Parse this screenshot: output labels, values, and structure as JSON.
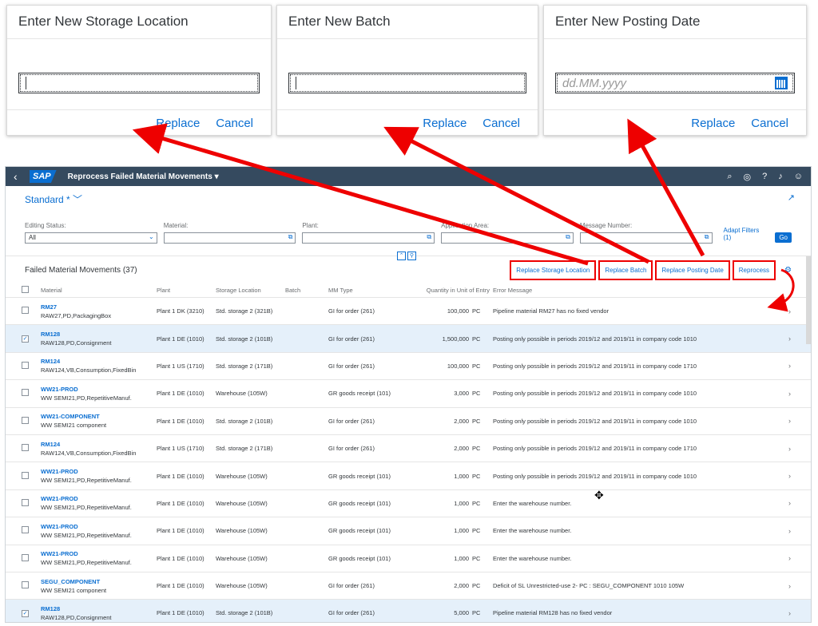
{
  "dialogs": [
    {
      "title": "Enter New Storage Location",
      "value": "",
      "placeholder": "",
      "replace": "Replace",
      "cancel": "Cancel",
      "has_calendar": false
    },
    {
      "title": "Enter New Batch",
      "value": "",
      "placeholder": "",
      "replace": "Replace",
      "cancel": "Cancel",
      "has_calendar": false
    },
    {
      "title": "Enter New Posting Date",
      "value": "",
      "placeholder": "dd.MM.yyyy",
      "replace": "Replace",
      "cancel": "Cancel",
      "has_calendar": true
    }
  ],
  "shell": {
    "back": "‹",
    "logo": "SAP",
    "title": "Reprocess Failed Material Movements ▾"
  },
  "header": {
    "variant": "Standard * ﹀"
  },
  "filters": [
    {
      "label": "Editing Status:",
      "value": "All",
      "icon": "chevron-down-icon"
    },
    {
      "label": "Material:",
      "value": "",
      "icon": "value-help-icon"
    },
    {
      "label": "Plant:",
      "value": "",
      "icon": "value-help-icon"
    },
    {
      "label": "Application Area:",
      "value": "",
      "icon": "value-help-icon"
    },
    {
      "label": "Message Number:",
      "value": "",
      "icon": "value-help-icon"
    }
  ],
  "filterbar": {
    "adapt": "Adapt Filters (1)",
    "go": "Go"
  },
  "table": {
    "title": "Failed Material Movements (37)",
    "actions": [
      "Replace Storage Location",
      "Replace Batch",
      "Replace Posting Date",
      "Reprocess"
    ],
    "columns": [
      "Material",
      "Plant",
      "Storage Location",
      "Batch",
      "MM Type",
      "Quantity in Unit of Entry",
      "Error Message"
    ],
    "rows": [
      {
        "id": "RM27",
        "desc": "RAW27,PD,PackagingBox",
        "plant": "Plant 1 DK (3210)",
        "sloc": "Std. storage 2 (321B)",
        "batch": "",
        "mmt": "GI for order (261)",
        "qty": "100,000",
        "unit": "PC",
        "err": "Pipeline material RM27 has no fixed vendor",
        "sel": false
      },
      {
        "id": "RM128",
        "desc": "RAW128,PD,Consignment",
        "plant": "Plant 1 DE (1010)",
        "sloc": "Std. storage 2 (101B)",
        "batch": "",
        "mmt": "GI for order (261)",
        "qty": "1,500,000",
        "unit": "PC",
        "err": "Posting only possible in periods 2019/12 and 2019/11 in company code 1010",
        "sel": true
      },
      {
        "id": "RM124",
        "desc": "RAW124,VB,Consumption,FixedBin",
        "plant": "Plant 1 US (1710)",
        "sloc": "Std. storage 2 (171B)",
        "batch": "",
        "mmt": "GI for order (261)",
        "qty": "100,000",
        "unit": "PC",
        "err": "Posting only possible in periods 2019/12 and 2019/11 in company code 1710",
        "sel": false
      },
      {
        "id": "WW21-PROD",
        "desc": "WW SEMI21,PD,RepetitiveManuf.",
        "plant": "Plant 1 DE (1010)",
        "sloc": "Warehouse (105W)",
        "batch": "",
        "mmt": "GR goods receipt (101)",
        "qty": "3,000",
        "unit": "PC",
        "err": "Posting only possible in periods 2019/12 and 2019/11 in company code 1010",
        "sel": false
      },
      {
        "id": "WW21-COMPONENT",
        "desc": "WW SEMI21 component",
        "plant": "Plant 1 DE (1010)",
        "sloc": "Std. storage 2 (101B)",
        "batch": "",
        "mmt": "GI for order (261)",
        "qty": "2,000",
        "unit": "PC",
        "err": "Posting only possible in periods 2019/12 and 2019/11 in company code 1010",
        "sel": false
      },
      {
        "id": "RM124",
        "desc": "RAW124,VB,Consumption,FixedBin",
        "plant": "Plant 1 US (1710)",
        "sloc": "Std. storage 2 (171B)",
        "batch": "",
        "mmt": "GI for order (261)",
        "qty": "2,000",
        "unit": "PC",
        "err": "Posting only possible in periods 2019/12 and 2019/11 in company code 1710",
        "sel": false
      },
      {
        "id": "WW21-PROD",
        "desc": "WW SEMI21,PD,RepetitiveManuf.",
        "plant": "Plant 1 DE (1010)",
        "sloc": "Warehouse (105W)",
        "batch": "",
        "mmt": "GR goods receipt (101)",
        "qty": "1,000",
        "unit": "PC",
        "err": "Posting only possible in periods 2019/12 and 2019/11 in company code 1010",
        "sel": false
      },
      {
        "id": "WW21-PROD",
        "desc": "WW SEMI21,PD,RepetitiveManuf.",
        "plant": "Plant 1 DE (1010)",
        "sloc": "Warehouse (105W)",
        "batch": "",
        "mmt": "GR goods receipt (101)",
        "qty": "1,000",
        "unit": "PC",
        "err": "Enter the warehouse number.",
        "sel": false
      },
      {
        "id": "WW21-PROD",
        "desc": "WW SEMI21,PD,RepetitiveManuf.",
        "plant": "Plant 1 DE (1010)",
        "sloc": "Warehouse (105W)",
        "batch": "",
        "mmt": "GR goods receipt (101)",
        "qty": "1,000",
        "unit": "PC",
        "err": "Enter the warehouse number.",
        "sel": false
      },
      {
        "id": "WW21-PROD",
        "desc": "WW SEMI21,PD,RepetitiveManuf.",
        "plant": "Plant 1 DE (1010)",
        "sloc": "Warehouse (105W)",
        "batch": "",
        "mmt": "GR goods receipt (101)",
        "qty": "1,000",
        "unit": "PC",
        "err": "Enter the warehouse number.",
        "sel": false
      },
      {
        "id": "SEGU_COMPONENT",
        "desc": "WW SEMI21 component",
        "plant": "Plant 1 DE (1010)",
        "sloc": "Warehouse (105W)",
        "batch": "",
        "mmt": "GI for order (261)",
        "qty": "2,000",
        "unit": "PC",
        "err": "Deficit of SL Unrestricted-use 2- PC : SEGU_COMPONENT 1010 105W",
        "sel": false
      },
      {
        "id": "RM128",
        "desc": "RAW128,PD,Consignment",
        "plant": "Plant 1 DE (1010)",
        "sloc": "Std. storage 2 (101B)",
        "batch": "",
        "mmt": "GI for order (261)",
        "qty": "5,000",
        "unit": "PC",
        "err": "Pipeline material RM128 has no fixed vendor",
        "sel": true
      }
    ]
  },
  "colors": {
    "accent": "#0a6ed1",
    "shell": "#354a5f",
    "annotation": "#ee0000",
    "selected_row": "#e5f0fa"
  }
}
